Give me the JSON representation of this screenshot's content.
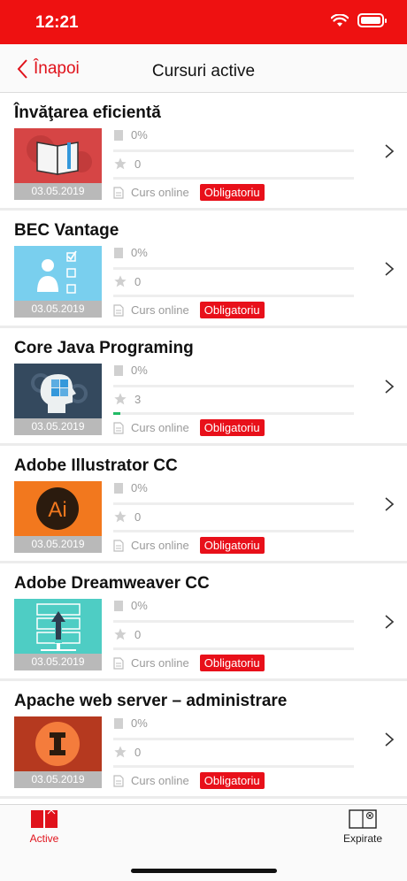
{
  "status_bar": {
    "time": "12:21"
  },
  "nav": {
    "back_label": "Înapoi",
    "title": "Cursuri active"
  },
  "courses": [
    {
      "title": "Învăţarea eficientă",
      "date": "03.05.2019",
      "progress": "0%",
      "rating": "0",
      "rating_fill": 0,
      "type": "Curs online",
      "badge": "Obligatoriu",
      "thumb_bg": "#d64545",
      "thumb_icon": "book-icon"
    },
    {
      "title": "BEC Vantage",
      "date": "03.05.2019",
      "progress": "0%",
      "rating": "0",
      "rating_fill": 0,
      "type": "Curs online",
      "badge": "Obligatoriu",
      "thumb_bg": "#79cfee",
      "thumb_icon": "checklist-person-icon"
    },
    {
      "title": "Core Java Programing",
      "date": "03.05.2019",
      "progress": "0%",
      "rating": "3",
      "rating_fill": 0.03,
      "type": "Curs online",
      "badge": "Obligatoriu",
      "thumb_bg": "#34495e",
      "thumb_icon": "head-puzzle-icon"
    },
    {
      "title": "Adobe Illustrator CC",
      "date": "03.05.2019",
      "progress": "0%",
      "rating": "0",
      "rating_fill": 0,
      "type": "Curs online",
      "badge": "Obligatoriu",
      "thumb_bg": "#f2781e",
      "thumb_icon": "illustrator-icon",
      "thumb_text": "Ai"
    },
    {
      "title": "Adobe Dreamweaver CC",
      "date": "03.05.2019",
      "progress": "0%",
      "rating": "0",
      "rating_fill": 0,
      "type": "Curs online",
      "badge": "Obligatoriu",
      "thumb_bg": "#4ecdc4",
      "thumb_icon": "server-upload-icon"
    },
    {
      "title": "Apache web server – administrare",
      "date": "03.05.2019",
      "progress": "0%",
      "rating": "0",
      "rating_fill": 0,
      "type": "Curs online",
      "badge": "Obligatoriu",
      "thumb_bg": "#b5391f",
      "thumb_icon": "apache-icon"
    }
  ],
  "tabs": {
    "active_label": "Active",
    "expired_label": "Expirate"
  },
  "colors": {
    "accent": "#e0121b",
    "status_bar": "#ee1111",
    "badge": "#e8101a",
    "rating_bar": "#22bb66"
  }
}
